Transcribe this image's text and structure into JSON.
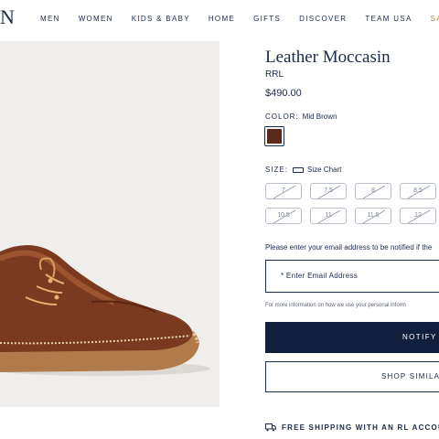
{
  "header": {
    "logo": "N",
    "nav": [
      "MEN",
      "WOMEN",
      "KIDS & BABY",
      "HOME",
      "GIFTS",
      "DISCOVER",
      "TEAM USA",
      "SALE"
    ]
  },
  "product": {
    "title": "Leather Moccasin",
    "brand": "RRL",
    "price": "$490.00",
    "color_label": "COLOR:",
    "color_value": "Mid Brown",
    "swatch_color": "#5a2a1c",
    "size_label": "SIZE:",
    "size_chart": "Size Chart",
    "sizes": [
      {
        "label": "7",
        "available": false
      },
      {
        "label": "7.5",
        "available": false
      },
      {
        "label": "8",
        "available": false
      },
      {
        "label": "8.5",
        "available": false
      },
      {
        "label": "10.5",
        "available": false
      },
      {
        "label": "11",
        "available": false
      },
      {
        "label": "11.5",
        "available": false
      },
      {
        "label": "12",
        "available": false
      }
    ]
  },
  "notify": {
    "prompt": "Please enter your email address to be notified if the",
    "email_placeholder": "* Enter Email Address",
    "info": "For more information on how we use your personal inform",
    "notify_button": "NOTIFY M",
    "similar_button": "SHOP SIMILAR"
  },
  "shipping": "FREE SHIPPING WITH AN RL ACCOUNT",
  "colors": {
    "navy": "#0f1f3d",
    "sale": "#b5893a",
    "photo_bg": "#efeeec"
  }
}
